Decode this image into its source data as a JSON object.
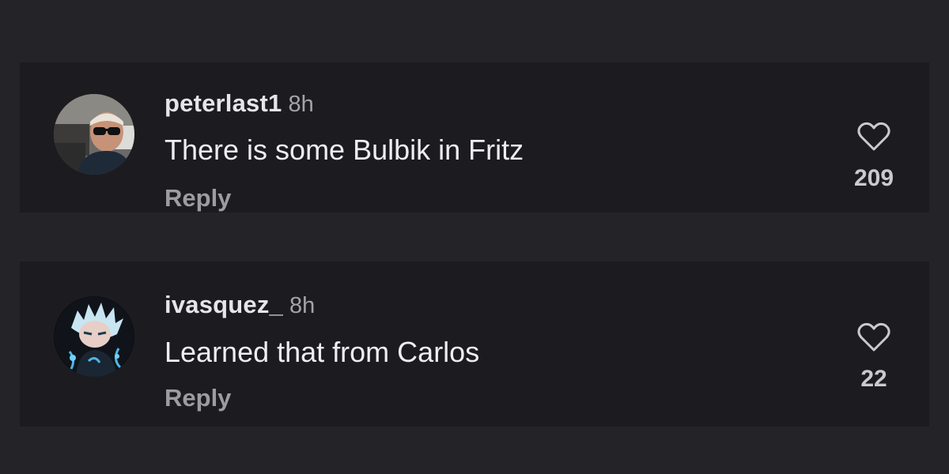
{
  "comments": [
    {
      "username": "peterlast1",
      "time": "8h",
      "text": "There is some Bulbik in Fritz",
      "reply_label": "Reply",
      "likes": "209",
      "avatar_icon": "person-sunglasses-photo"
    },
    {
      "username": "ivasquez_",
      "time": "8h",
      "text": "Learned that from Carlos",
      "reply_label": "Reply",
      "likes": "22",
      "avatar_icon": "anime-character-glow"
    }
  ],
  "colors": {
    "background": "#232328",
    "card": "#1c1c20",
    "primary_text": "#eeeef0",
    "secondary_text": "#9c9ca3"
  }
}
